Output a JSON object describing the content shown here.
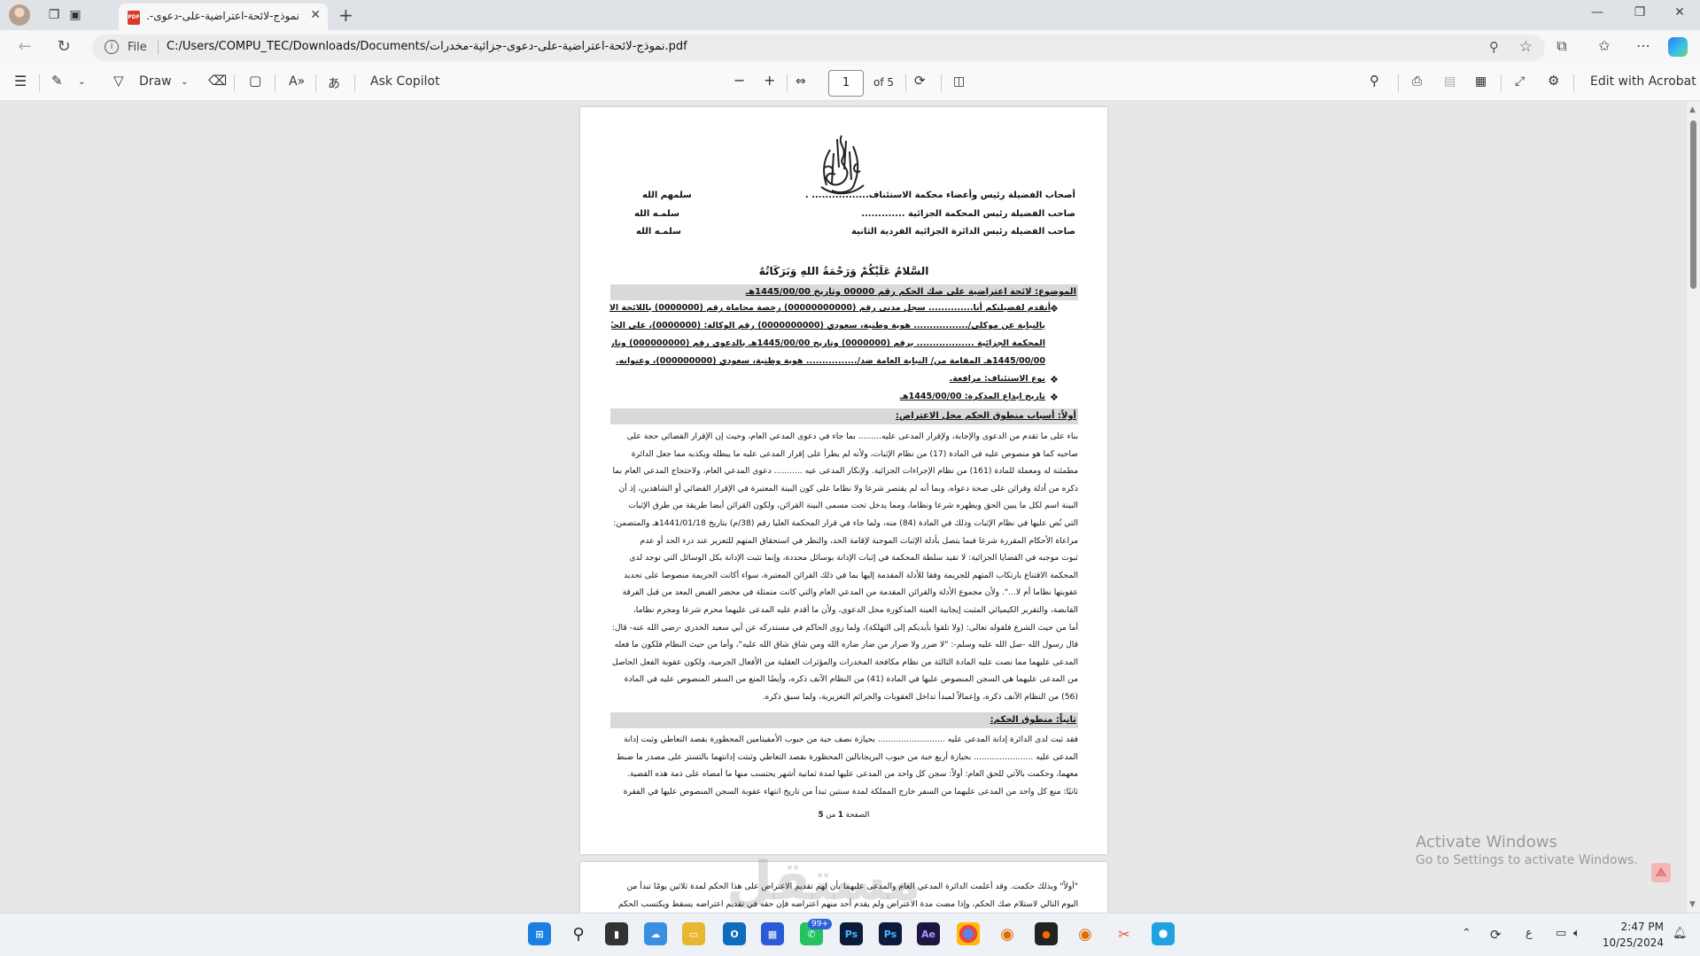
{
  "browser": {
    "tab_title": "نموذج-لائحة-اعتراضية-على-دعوى-...",
    "tab_icon_label": "PDF",
    "address_scheme": "File",
    "url": "C:/Users/COMPU_TEC/Downloads/Documents/نموذج-لائحة-اعتراضية-على-دعوى-جزائية-مخدرات.pdf"
  },
  "pdf_toolbar": {
    "draw_label": "Draw",
    "ask_copilot_label": "Ask Copilot",
    "page_current": "1",
    "page_total_label": "of 5",
    "edit_acrobat_label": "Edit with Acrobat"
  },
  "document": {
    "addressees": [
      {
        "text": "أصحاب الفضيلة رئيس وأعضاء محكمة الاستئناف................. .",
        "salute": "سلمهم الله"
      },
      {
        "text": "صاحب الفضيلة رئيس المحكمة الجزائية .............",
        "salute": "سلمـه الله"
      },
      {
        "text": "صاحب الفضيلة رئيس الدائرة الجزائية الفردية الثانية",
        "salute": "سلمـه الله"
      }
    ],
    "greeting": "السَّلامُ عَلَيْكُمْ وَرَحْمَةُ اللهِ وَبَرَكَاتُهُ",
    "subject": "الموضوع: لائحة اعتراضية على صك الحكم رقم 00000 وتاريخ 1445/00/00هـ",
    "intro_lines": [
      "أتقدم لفضيلتكم أنا.............. سجل مدني رقم (00000000000) رخصة محاماة رقم (0000000) باللائحة الاعتراضية",
      "بالنيابة عن موكلي/................. هوية وطنية، سعودي (0000000000) رقم الوكالة: (0000000)، على الحكم الصادر من",
      "المحكمة الجزائية .................. برقم (0000000) وتاريخ 1445/00/00هـ بالدعوى رقم (000000000) وتاريخ",
      "1445/00/00هـ المقامة من/ النيابة العامة ضد/................ هوية وطنية، سعودي (000000000)، وعنوانه."
    ],
    "appeal_type": "نوع الاستئناف: مرافعة.",
    "memo_date": "تاريخ ايداع المذكرة: 1445/00/00هـ",
    "section1_title": "أولاً: أسباب منطوق الحكم محل الاعتراض:",
    "section1_lines": [
      "بناء على ما تقدم من الدعوى والإجابة، ولإقرار المدعى عليه......... بما جاء في دعوى المدعي العام، وحيث إن الإقرار القضائي حجة على",
      "صاحبه كما هو منصوص عليه في المادة (17) من نظام الإثبات، ولأنه لم يطرأ على إقرار المدعى عليه ما يبطله ويكذبه مما جعل الدائرة",
      "مطمئنة له ومعملة للمادة (161) من نظام الإجراءات الجزائية. ولإنكار المدعى عيه ........... دعوى المدعي العام، ولاحتجاج المدعي العام بما",
      "ذكره من أدلة وقرائن على صحة دعواه، وبما أنه لم يقتصر شرعا ولا نظاما على كون البينة المعتبرة في الإقرار القضائي أو الشاهدين، إذ أن",
      "البينة اسم لكل ما يبين الحق ويظهره شرعا ونظاما، ومما يدخل تحت مسمى البينة القرائن، ولكون القرائن أيضا طريقة من طرق الإثبات",
      "التي نُص عليها في نظام الإثبات وذلك في المادة (84) منه، ولما جاء في قرار المحكمة العليا رقم (38/م) بتاريخ 1441/01/18هـ والمتضمن: \"مع",
      "مراعاة الأحكام المقررة شرعا فيما يتصل بأدلة الإثبات الموجبة لإقامة الحد، والنظر في استحقاق المتهم للتعزير عند درء الحد أو عدم",
      "ثبوت موجبه في القضايا الجزائية: لا تقيد سلطة المحكمة في إثبات الإدانة بوسائل محددة، وإنما تثبت الإدانة بكل الوسائل التي توجد لدى",
      "المحكمة الاقتناع بارتكاب المتهم للجريمة وفقا للأدلة المقدمة إليها بما في ذلك القرائن المعتبرة، سواء أكانت الجريمة منصوصا على تحديد",
      "عقوبتها نظاما أم لا...\". ولأن مجموع الأدلة والقرائن المقدمة من المدعي العام والتي كانت متمثلة في محضر القبض المعد من قبل الفرقة",
      "القابضة، والتقرير الكيميائي المثبت إيجابية العينة المذكورة محل الدعوى، ولأن ما أقدم عليه المدعى عليهما محرم شرعا ومجرم نظاما،",
      "أما من حيث الشرع فلقوله تعالى: (ولا تلقوا بأيديكم إلى التهلكة)، ولما روى الحاكم في مستدركه عن أبي سعيد الخدري -رضي الله عنه- قال:",
      "قال رسول الله -صل الله عليه وسلم-: \"لا ضرر ولا ضرار من ضار ضاره الله ومن شاق شاق الله عليه\"، وأما من حيث النظام فلكون ما فعله",
      "المدعى عليهما مما نصت عليه المادة الثالثة من نظام مكافحة المخدرات والمؤثرات العقلية من الأفعال الجرمية، ولكون عقوبة الفعل الحاصل",
      "من المدعى عليهما هي السجن المنصوص عليها في المادة (41) من النظام الآنف ذكره، وأيضًا المنع من السفر المنصوص عليه في المادة",
      "(56) من النظام الآنف ذكره، وإعمالاً لمبدأ تداخل العقوبات والجرائم التعزيرية، ولما سبق ذكره."
    ],
    "section2_title": "ثانياً: منطوق الحكم:",
    "section2_lines": [
      "فقد ثبت لدى الدائرة إدانة المدعى عليه .......................... بحيازة نصف حبة من حبوب الأمفيتامين المحظورة بقصد التعاطي وثبت إدانة",
      "المدعى عليه ....................... بحيازة أربع حبة من حبوب البريجابالين المحظورة بقصد التعاطي وثبتت إدانتهما بالتستر على مصدر ما ضبط",
      "معهما، وحكمت بالآتي للحق العام: أولاً: سجن كل واحد من المدعى عليها لمدة ثمانية أشهر يحتسب منها ما أمضاه على ذمة هذه القضية.",
      "ثانيًا: منع كل واحد من المدعى عليهما من السفر خارج المملكة لمدة سنتين تبدأ من تاريخ انتهاء عقوبة السجن المنصوص عليها في الفقرة"
    ],
    "footer_prefix": "الصفحة",
    "footer_page": "1",
    "footer_of": "من",
    "footer_total": "5",
    "page2_lines": [
      "\"أولاً\" وبذلك حكمت. وقد أعلمت الدائرة المدعي العام والمدعى عليهما بأن لهم تقديم الاعتراض على هذا الحكم لمدة ثلاثين يومًا تبدأ من",
      "اليوم التالي لاستلام صك الحكم، وإذا مضت مدة الاعتراض ولم يقدم أحد منهم اعتراضه فإن حقه في تقديم اعتراضه يسقط ويكتسب الحكم"
    ]
  },
  "overlay": {
    "watermark": "مستقل",
    "activate_title": "Activate Windows",
    "activate_sub": "Go to Settings to activate Windows."
  },
  "taskbar": {
    "badge": "99+",
    "time": "2:47 PM",
    "date": "10/25/2024",
    "lang": "ع"
  }
}
